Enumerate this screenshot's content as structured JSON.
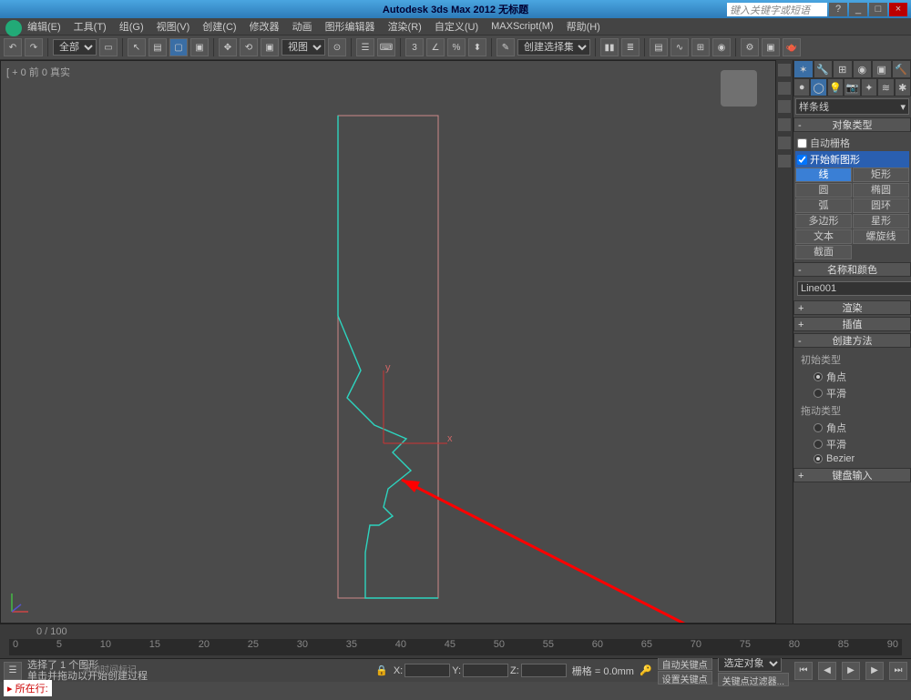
{
  "title": "Autodesk 3ds Max  2012        无标题",
  "search_placeholder": "键入关键字或短语",
  "winbtns": {
    "min": "_",
    "max": "□",
    "close": "×"
  },
  "menu": [
    "编辑(E)",
    "工具(T)",
    "组(G)",
    "视图(V)",
    "创建(C)",
    "修改器",
    "动画",
    "图形编辑器",
    "渲染(R)",
    "自定义(U)",
    "MAXScript(M)",
    "帮助(H)"
  ],
  "toolbar": {
    "set_sel": "全部",
    "view_sel": "视图",
    "create_sel": "创建选择集"
  },
  "viewport_label": "[ + 0 前 0 真实",
  "panel": {
    "shape_type": "样条线",
    "roll_objtype": "对象类型",
    "autogrid": "自动栅格",
    "startnew": "开始新图形",
    "buttons": [
      [
        "线",
        "矩形"
      ],
      [
        "圆",
        "椭圆"
      ],
      [
        "弧",
        "圆环"
      ],
      [
        "多边形",
        "星形"
      ],
      [
        "文本",
        "螺旋线"
      ],
      [
        "截面",
        ""
      ]
    ],
    "sel_button": "线",
    "roll_name": "名称和颜色",
    "obj_name": "Line001",
    "roll_render": "渲染",
    "roll_interp": "插值",
    "roll_method": "创建方法",
    "init_type": "初始类型",
    "drag_type": "拖动类型",
    "opt_corner": "角点",
    "opt_smooth": "平滑",
    "opt_bezier": "Bezier",
    "roll_keyboard": "键盘输入"
  },
  "timeline": {
    "range": "0 / 100",
    "ticks": [
      "0",
      "5",
      "10",
      "15",
      "20",
      "25",
      "30",
      "35",
      "40",
      "45",
      "50",
      "55",
      "60",
      "65",
      "70",
      "75",
      "80",
      "85",
      "90"
    ]
  },
  "status": {
    "sel": "选择了 1 个图形",
    "hint": "单击并拖动以开始创建过程",
    "grid": "栅格 = 0.0mm",
    "autokey": "自动关键点",
    "setkey": "设置关键点",
    "selobj": "选定对象",
    "keyfilter": "关键点过滤器...",
    "addtime": "添加时间标记",
    "lock": "🔒"
  },
  "prompt": "所在行:"
}
